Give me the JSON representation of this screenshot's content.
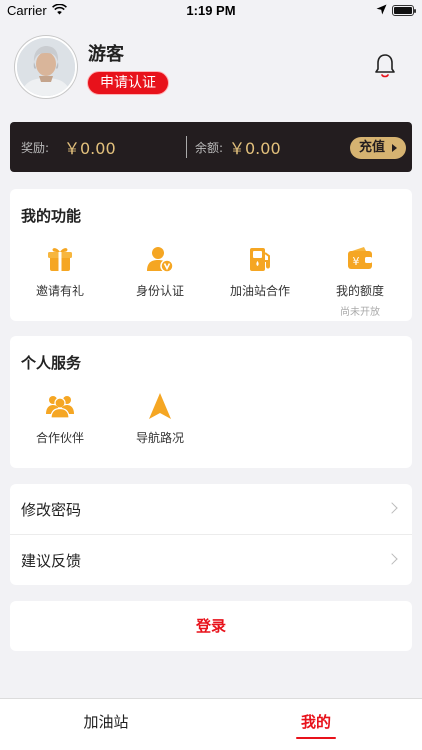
{
  "status_bar": {
    "carrier": "Carrier",
    "time": "1:19 PM"
  },
  "profile": {
    "username": "游客",
    "certify_button": "申请认证",
    "notification_icon": "bell-icon"
  },
  "balance": {
    "reward_label": "奖励:",
    "reward_value": "￥0.00",
    "balance_label": "余额:",
    "balance_value": "￥0.00",
    "recharge_button": "充值"
  },
  "functions": {
    "title": "我的功能",
    "items": [
      {
        "label": "邀请有礼",
        "icon": "gift-icon"
      },
      {
        "label": "身份认证",
        "icon": "user-verify-icon"
      },
      {
        "label": "加油站合作",
        "icon": "fuel-pump-icon"
      },
      {
        "label": "我的额度",
        "sub": "尚未开放",
        "icon": "wallet-yen-icon"
      }
    ]
  },
  "services": {
    "title": "个人服务",
    "items": [
      {
        "label": "合作伙伴",
        "icon": "partners-icon"
      },
      {
        "label": "导航路况",
        "icon": "navigation-arrow-icon"
      }
    ]
  },
  "menu": {
    "items": [
      {
        "label": "修改密码"
      },
      {
        "label": "建议反馈"
      }
    ]
  },
  "login_button": "登录",
  "tabbar": {
    "tabs": [
      {
        "label": "加油站",
        "active": false
      },
      {
        "label": "我的",
        "active": true
      }
    ]
  },
  "colors": {
    "accent": "#e8121b",
    "icon_orange": "#f5a623",
    "card_dark": "#231d1f",
    "gold": "#d6b371"
  }
}
